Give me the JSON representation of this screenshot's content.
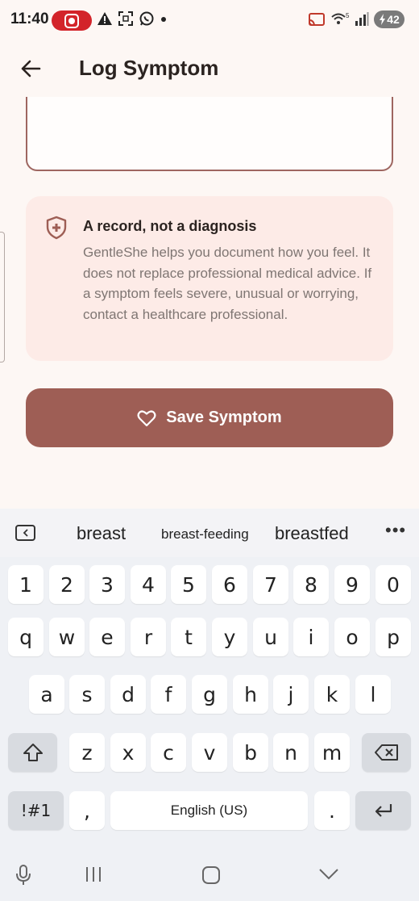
{
  "status_bar": {
    "time": "11:40",
    "battery": "42",
    "icons": [
      "screen-record-icon",
      "warning-icon",
      "scan-icon",
      "whatsapp-icon",
      "dot-icon",
      "cast-icon",
      "wifi-icon",
      "signal-icon",
      "battery-icon"
    ]
  },
  "app_bar": {
    "title": "Log Symptom"
  },
  "info_card": {
    "title": "A record, not a diagnosis",
    "body": "GentleShe helps you document how you feel. It does not replace professional medical advice. If a symptom feels severe, unusual or worrying, contact a healthcare professional."
  },
  "save_button": {
    "label": "Save Symptom"
  },
  "keyboard": {
    "suggestions": [
      "breast",
      "breast-feeding",
      "breastfed"
    ],
    "number_row": [
      "1",
      "2",
      "3",
      "4",
      "5",
      "6",
      "7",
      "8",
      "9",
      "0"
    ],
    "row1": [
      "q",
      "w",
      "e",
      "r",
      "t",
      "y",
      "u",
      "i",
      "o",
      "p"
    ],
    "row2": [
      "a",
      "s",
      "d",
      "f",
      "g",
      "h",
      "j",
      "k",
      "l"
    ],
    "row3": [
      "z",
      "x",
      "c",
      "v",
      "b",
      "n",
      "m"
    ],
    "symbols_label": "!#1",
    "comma": ",",
    "space_label": "English (US)",
    "period": "."
  },
  "colors": {
    "accent": "#9e5e55",
    "card_bg": "#fdebe7",
    "page_bg": "#fdf7f4",
    "recording_red": "#d3242a"
  }
}
